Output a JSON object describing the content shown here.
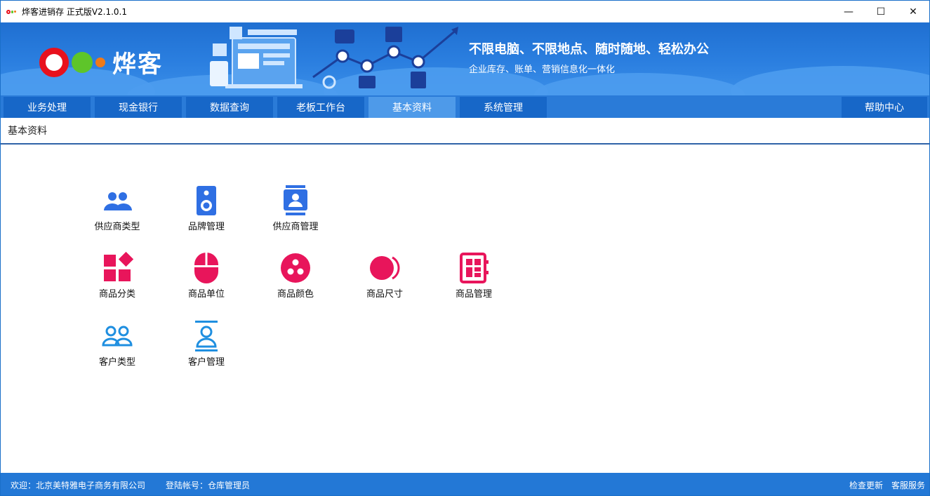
{
  "window": {
    "title": "烨客进销存   正式版V2.1.0.1",
    "minimize": "—",
    "maximize": "☐",
    "close": "✕"
  },
  "banner": {
    "logo_text": "烨客",
    "slogan_main": "不限电脑、不限地点、随时随地、轻松办公",
    "slogan_sub": "企业库存、账单、营销信息化一体化"
  },
  "nav": {
    "tabs": [
      {
        "label": "业务处理"
      },
      {
        "label": "现金银行"
      },
      {
        "label": "数据查询"
      },
      {
        "label": "老板工作台"
      },
      {
        "label": "基本资料"
      },
      {
        "label": "系统管理"
      }
    ],
    "help": "帮助中心",
    "active_tab": "基本资料"
  },
  "breadcrumb": "基本资料",
  "modules": [
    {
      "label": "供应商类型",
      "icon": "users-group-icon",
      "color": "#2f6fe3"
    },
    {
      "label": "品牌管理",
      "icon": "speaker-icon",
      "color": "#2f6fe3"
    },
    {
      "label": "供应商管理",
      "icon": "contact-card-icon",
      "color": "#2f6fe3"
    },
    {
      "label": "商品分类",
      "icon": "category-blocks-icon",
      "color": "#e8155b"
    },
    {
      "label": "商品单位",
      "icon": "mouse-icon",
      "color": "#e8155b"
    },
    {
      "label": "商品颜色",
      "icon": "color-palette-icon",
      "color": "#e8155b"
    },
    {
      "label": "商品尺寸",
      "icon": "size-circle-icon",
      "color": "#e8155b"
    },
    {
      "label": "商品管理",
      "icon": "product-grid-icon",
      "color": "#e8155b"
    },
    {
      "label": "客户类型",
      "icon": "customers-outline-icon",
      "color": "#1f8fe0"
    },
    {
      "label": "客户管理",
      "icon": "customer-profile-icon",
      "color": "#1f8fe0"
    }
  ],
  "status": {
    "welcome": "欢迎：北京美特雅电子商务有限公司",
    "account": "登陆帐号：仓库管理员",
    "check_update": "检查更新",
    "support": "客服服务"
  }
}
